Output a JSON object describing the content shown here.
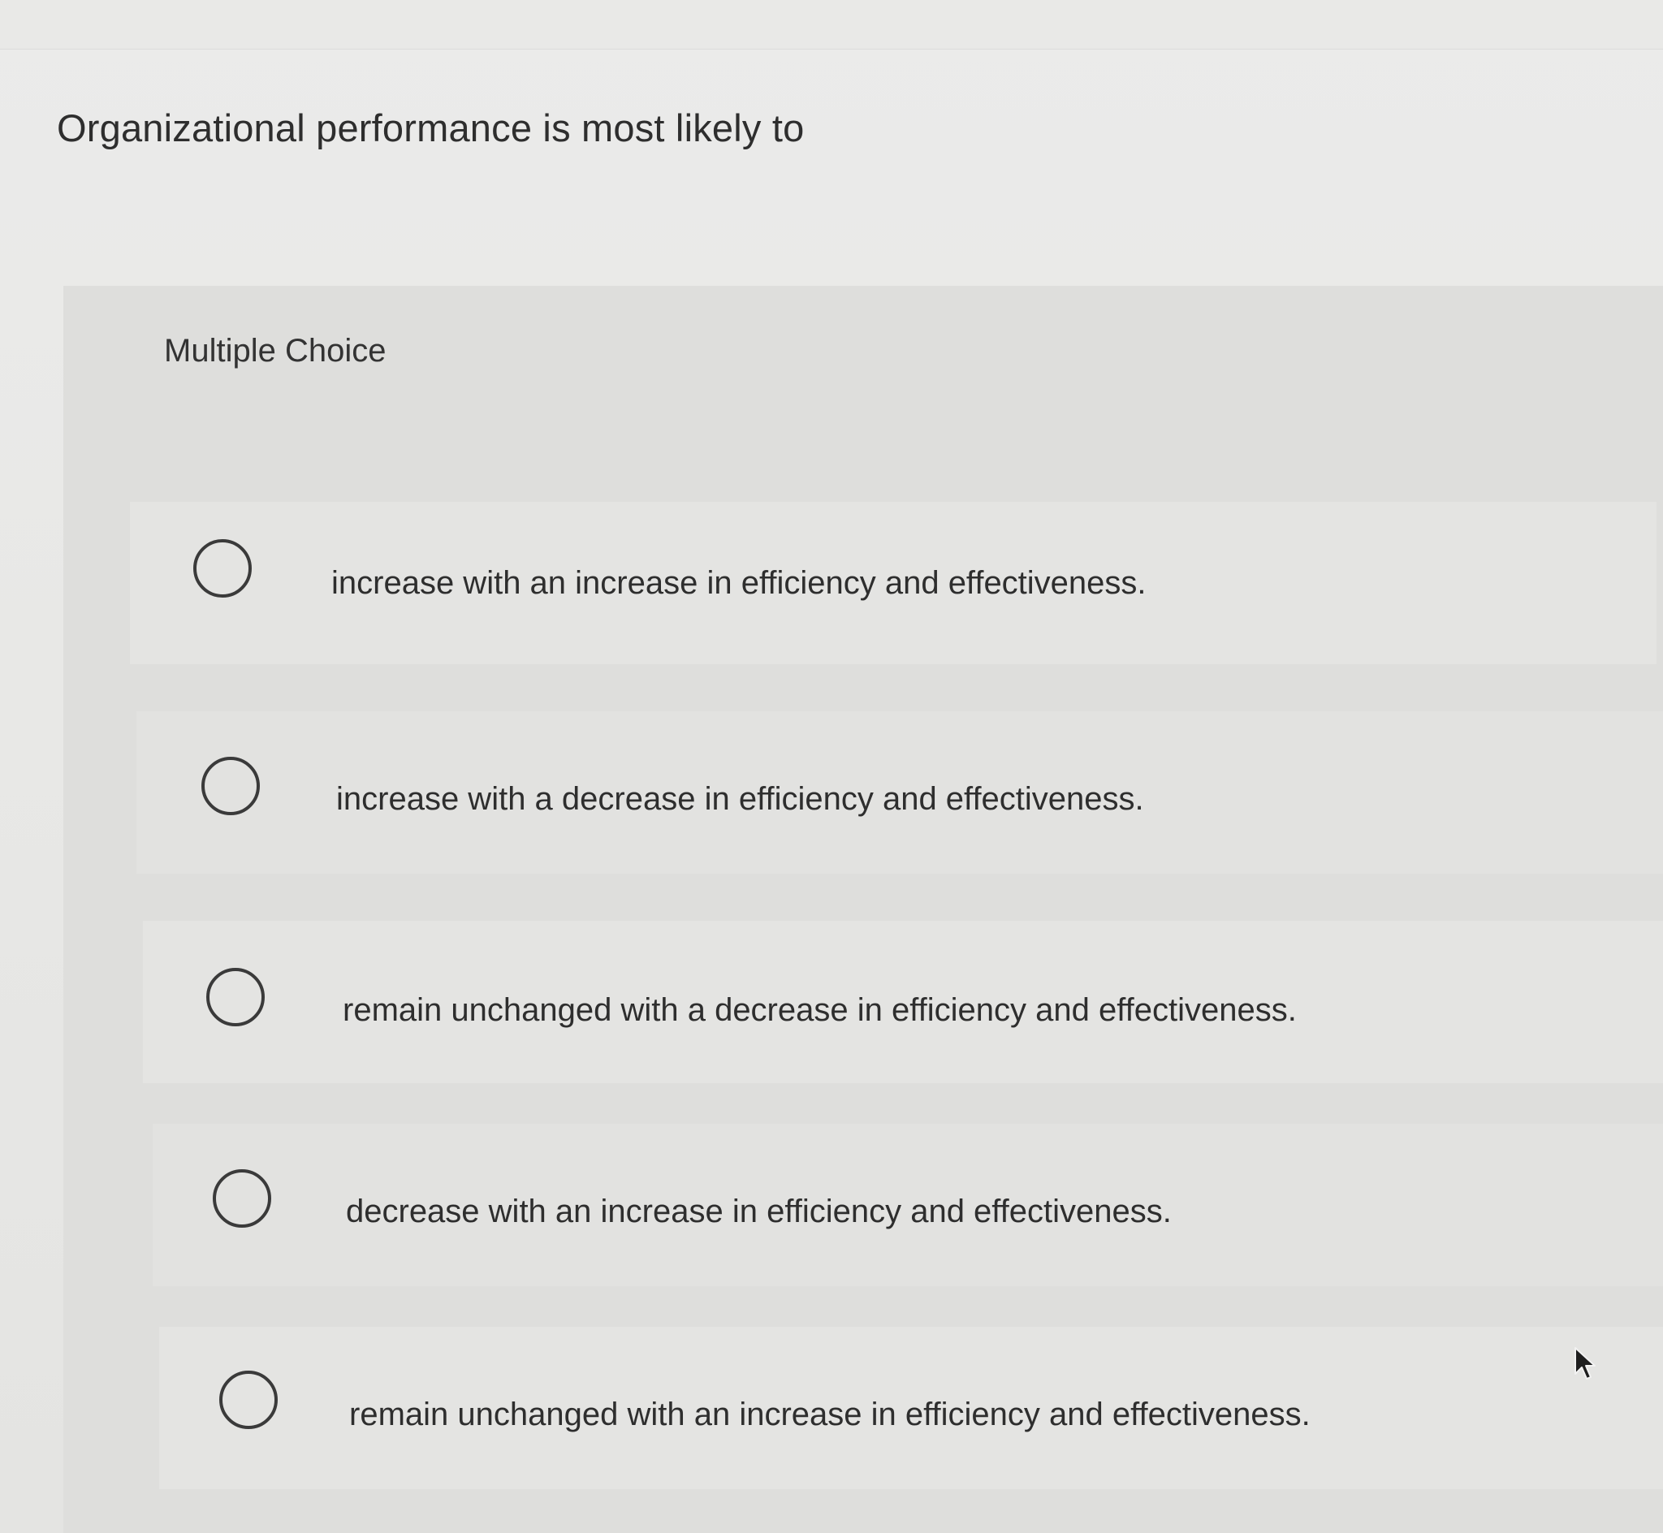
{
  "question": {
    "text": "Organizational performance is most likely to"
  },
  "answers": {
    "section_label": "Multiple Choice",
    "options": [
      {
        "label": "increase with an increase in efficiency and effectiveness."
      },
      {
        "label": "increase with a decrease in efficiency and effectiveness."
      },
      {
        "label": "remain unchanged with a decrease in efficiency and effectiveness."
      },
      {
        "label": "decrease with an increase in efficiency and effectiveness."
      },
      {
        "label": "remain unchanged with an increase in efficiency and effectiveness."
      }
    ]
  },
  "icons": {
    "radio": "radio-circle-icon",
    "cursor": "mouse-pointer-icon"
  },
  "colors": {
    "background": "#e6e6e4",
    "panel": "#dededc",
    "text": "#2e2e2e",
    "radio_border": "#3a3a3a"
  }
}
